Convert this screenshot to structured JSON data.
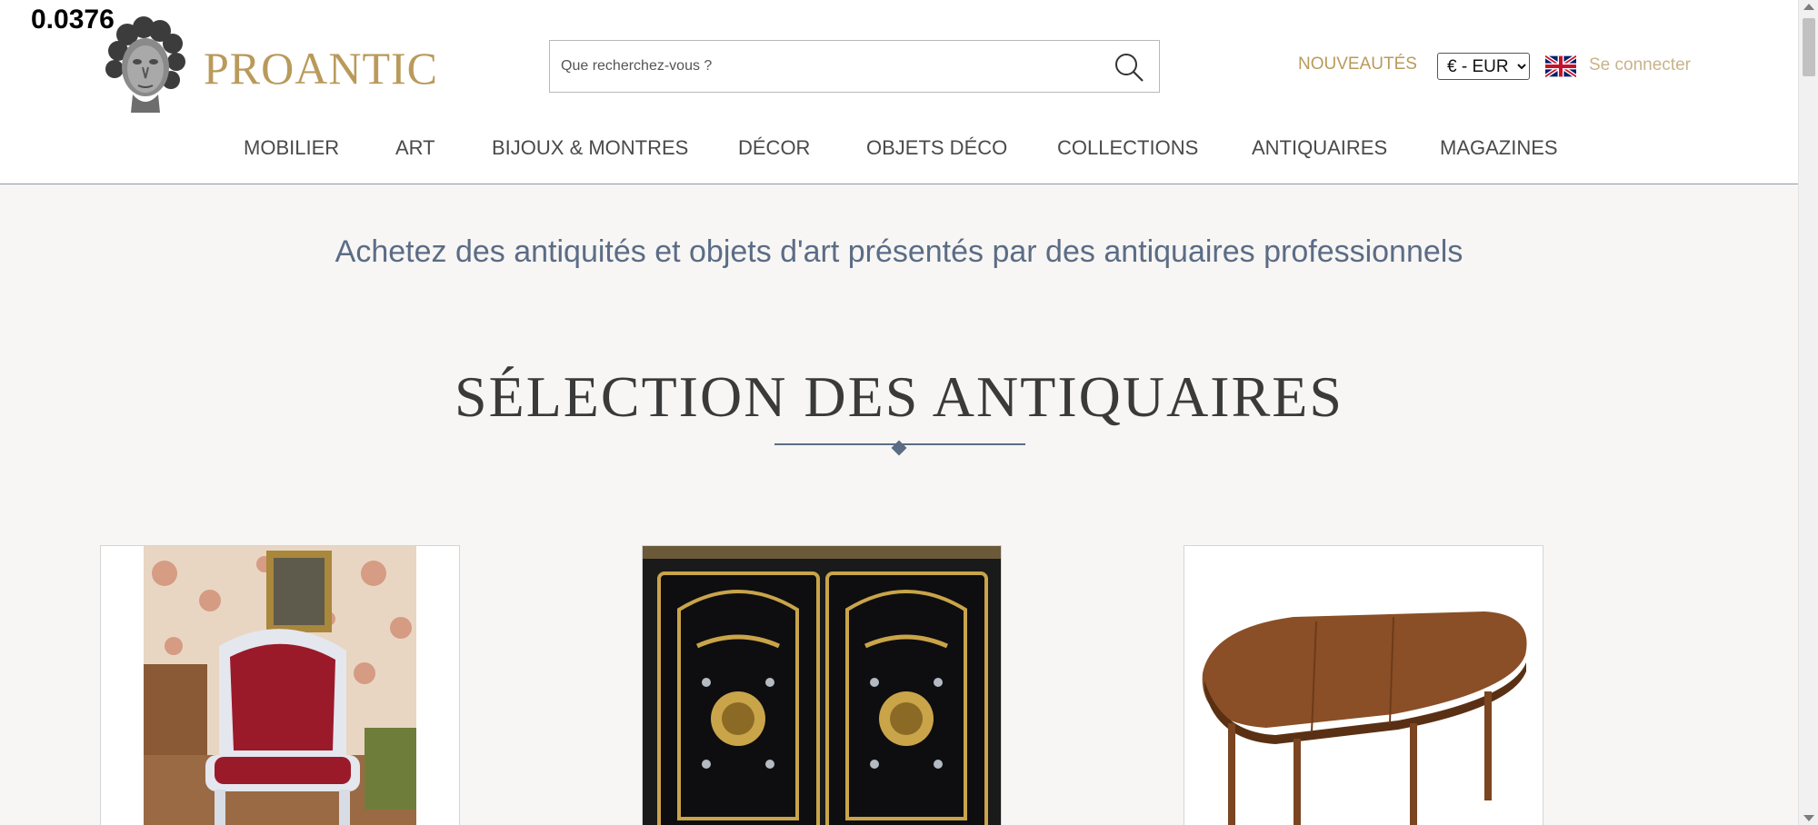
{
  "overlay": {
    "corner_value": "0.0376"
  },
  "header": {
    "brand": "PROANTIC",
    "search": {
      "placeholder": "Que recherchez-vous ?",
      "value": ""
    },
    "nouveautes": "NOUVEAUTÉS",
    "currency": {
      "options": [
        "€ - EUR"
      ],
      "selected": "€ - EUR"
    },
    "language_flag": "uk-flag-icon",
    "login": "Se connecter"
  },
  "nav": {
    "items": [
      {
        "label": "MOBILIER"
      },
      {
        "label": "ART"
      },
      {
        "label": "BIJOUX & MONTRES"
      },
      {
        "label": "DÉCOR"
      },
      {
        "label": "OBJETS DÉCO"
      },
      {
        "label": "COLLECTIONS"
      },
      {
        "label": "ANTIQUAIRES"
      },
      {
        "label": "MAGAZINES"
      }
    ]
  },
  "hero": {
    "tagline": "Achetez des antiquités et objets d'art présentés par des antiquaires professionnels",
    "section_title": "SÉLECTION DES ANTIQUAIRES"
  },
  "products": [
    {
      "image": "armchair-image"
    },
    {
      "image": "cabinet-image"
    },
    {
      "image": "table-image"
    }
  ],
  "colors": {
    "brand_gold": "#b99a5b",
    "accent_blue": "#5b6c85",
    "background": "#f7f6f4"
  }
}
